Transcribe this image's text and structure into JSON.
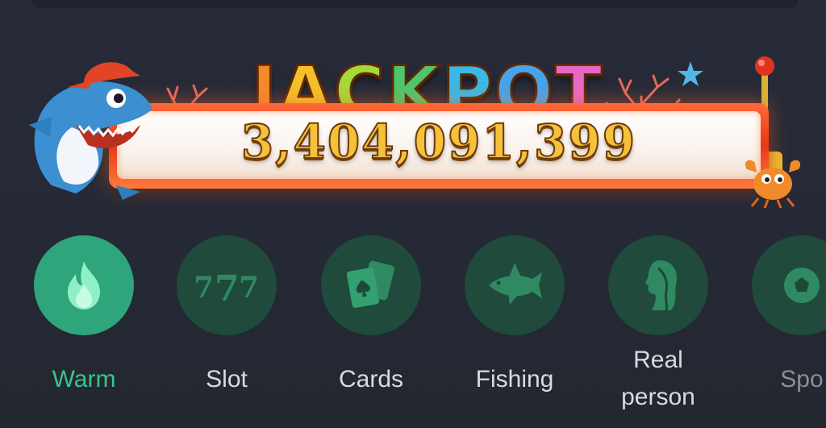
{
  "jackpot": {
    "title_letters": [
      "J",
      "A",
      "C",
      "K",
      "P",
      "O",
      "T"
    ],
    "amount": "3,404,091,399"
  },
  "categories": [
    {
      "label": "Warm",
      "icon": "flame-icon",
      "active": true
    },
    {
      "label": "Slot",
      "icon": "slot-777-icon",
      "active": false
    },
    {
      "label": "Cards",
      "icon": "playing-cards-icon",
      "active": false
    },
    {
      "label": "Fishing",
      "icon": "shark-icon",
      "active": false
    },
    {
      "label": "Real person",
      "icon": "woman-profile-icon",
      "active": false
    },
    {
      "label": "Spo",
      "icon": "sports-ball-icon",
      "active": false
    }
  ],
  "colors": {
    "background": "#262a37",
    "active_circle": "#2ea57a",
    "inactive_circle": "#1f4a3c",
    "active_label": "#38c48d",
    "label": "#d8dbe2",
    "jackpot_frame": "#e83818",
    "jackpot_digits": "#f5c03a"
  }
}
